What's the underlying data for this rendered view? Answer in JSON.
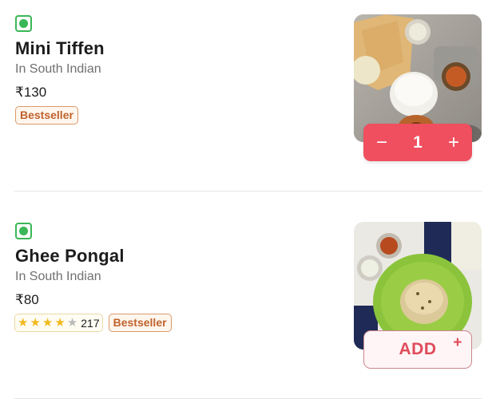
{
  "items": [
    {
      "name": "Mini Tiffen",
      "category": "In South Indian",
      "price": "₹130",
      "badge": "Bestseller",
      "diet": "veg",
      "image_icon": "south-indian-platter",
      "cart": {
        "quantity": "1",
        "decrement_symbol": "−",
        "increment_symbol": "+"
      }
    },
    {
      "name": "Ghee Pongal",
      "category": "In South Indian",
      "price": "₹80",
      "rating": {
        "value": 4,
        "max": 5,
        "count": "217"
      },
      "badge": "Bestseller",
      "diet": "veg",
      "image_icon": "pongal-plate",
      "add_label": "ADD",
      "add_plus": "+"
    }
  ],
  "colors": {
    "veg_green": "#3ab757",
    "accent_red": "#ef4f5f",
    "badge_orange": "#c0622c",
    "star_gold": "#f2b91e"
  }
}
